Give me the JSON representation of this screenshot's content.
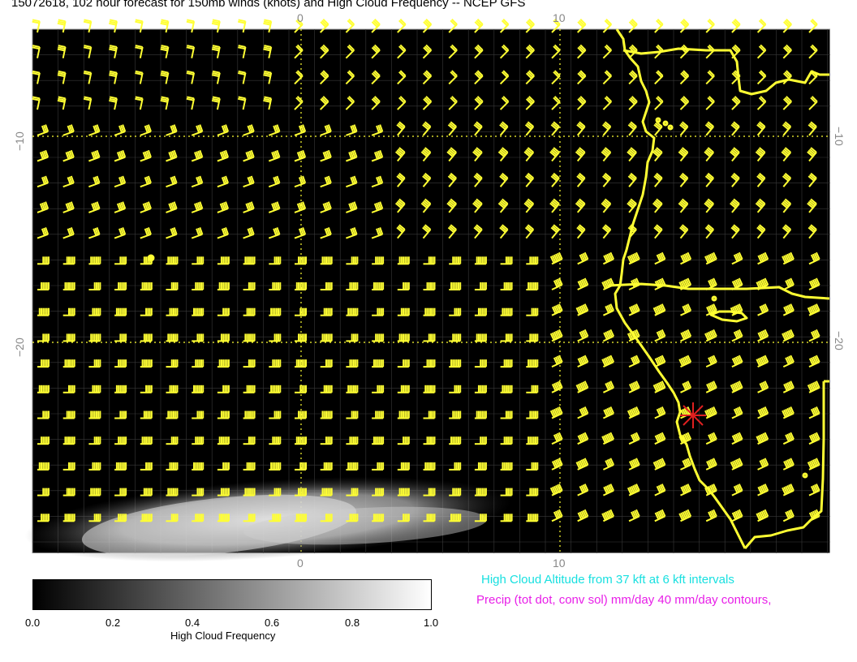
{
  "title": "15072618, 102 hour forecast for 150mb winds (knots) and High Cloud Frequency -- NCEP GFS",
  "axes": {
    "x_ticks_top": [
      "0",
      "10"
    ],
    "x_ticks_bottom": [
      "0",
      "10"
    ],
    "y_ticks_left": [
      "−10",
      "−20"
    ],
    "y_ticks_right": [
      "−10",
      "−20"
    ]
  },
  "colorbar": {
    "ticks": [
      "0.0",
      "0.2",
      "0.4",
      "0.6",
      "0.8",
      "1.0"
    ],
    "title": "High Cloud Frequency"
  },
  "legend": {
    "cyan_text": "High Cloud Altitude from 37 kft at 6 kft intervals",
    "magenta_text": "Precip (tot dot, conv sol) mm/day 40 mm/day contours,"
  },
  "colors": {
    "background": "#000000",
    "wind_barbs": "#ffff33",
    "coastline": "#ffff33",
    "marker": "#e02020",
    "cyan": "#18e0e0",
    "magenta": "#e81ee8"
  }
}
